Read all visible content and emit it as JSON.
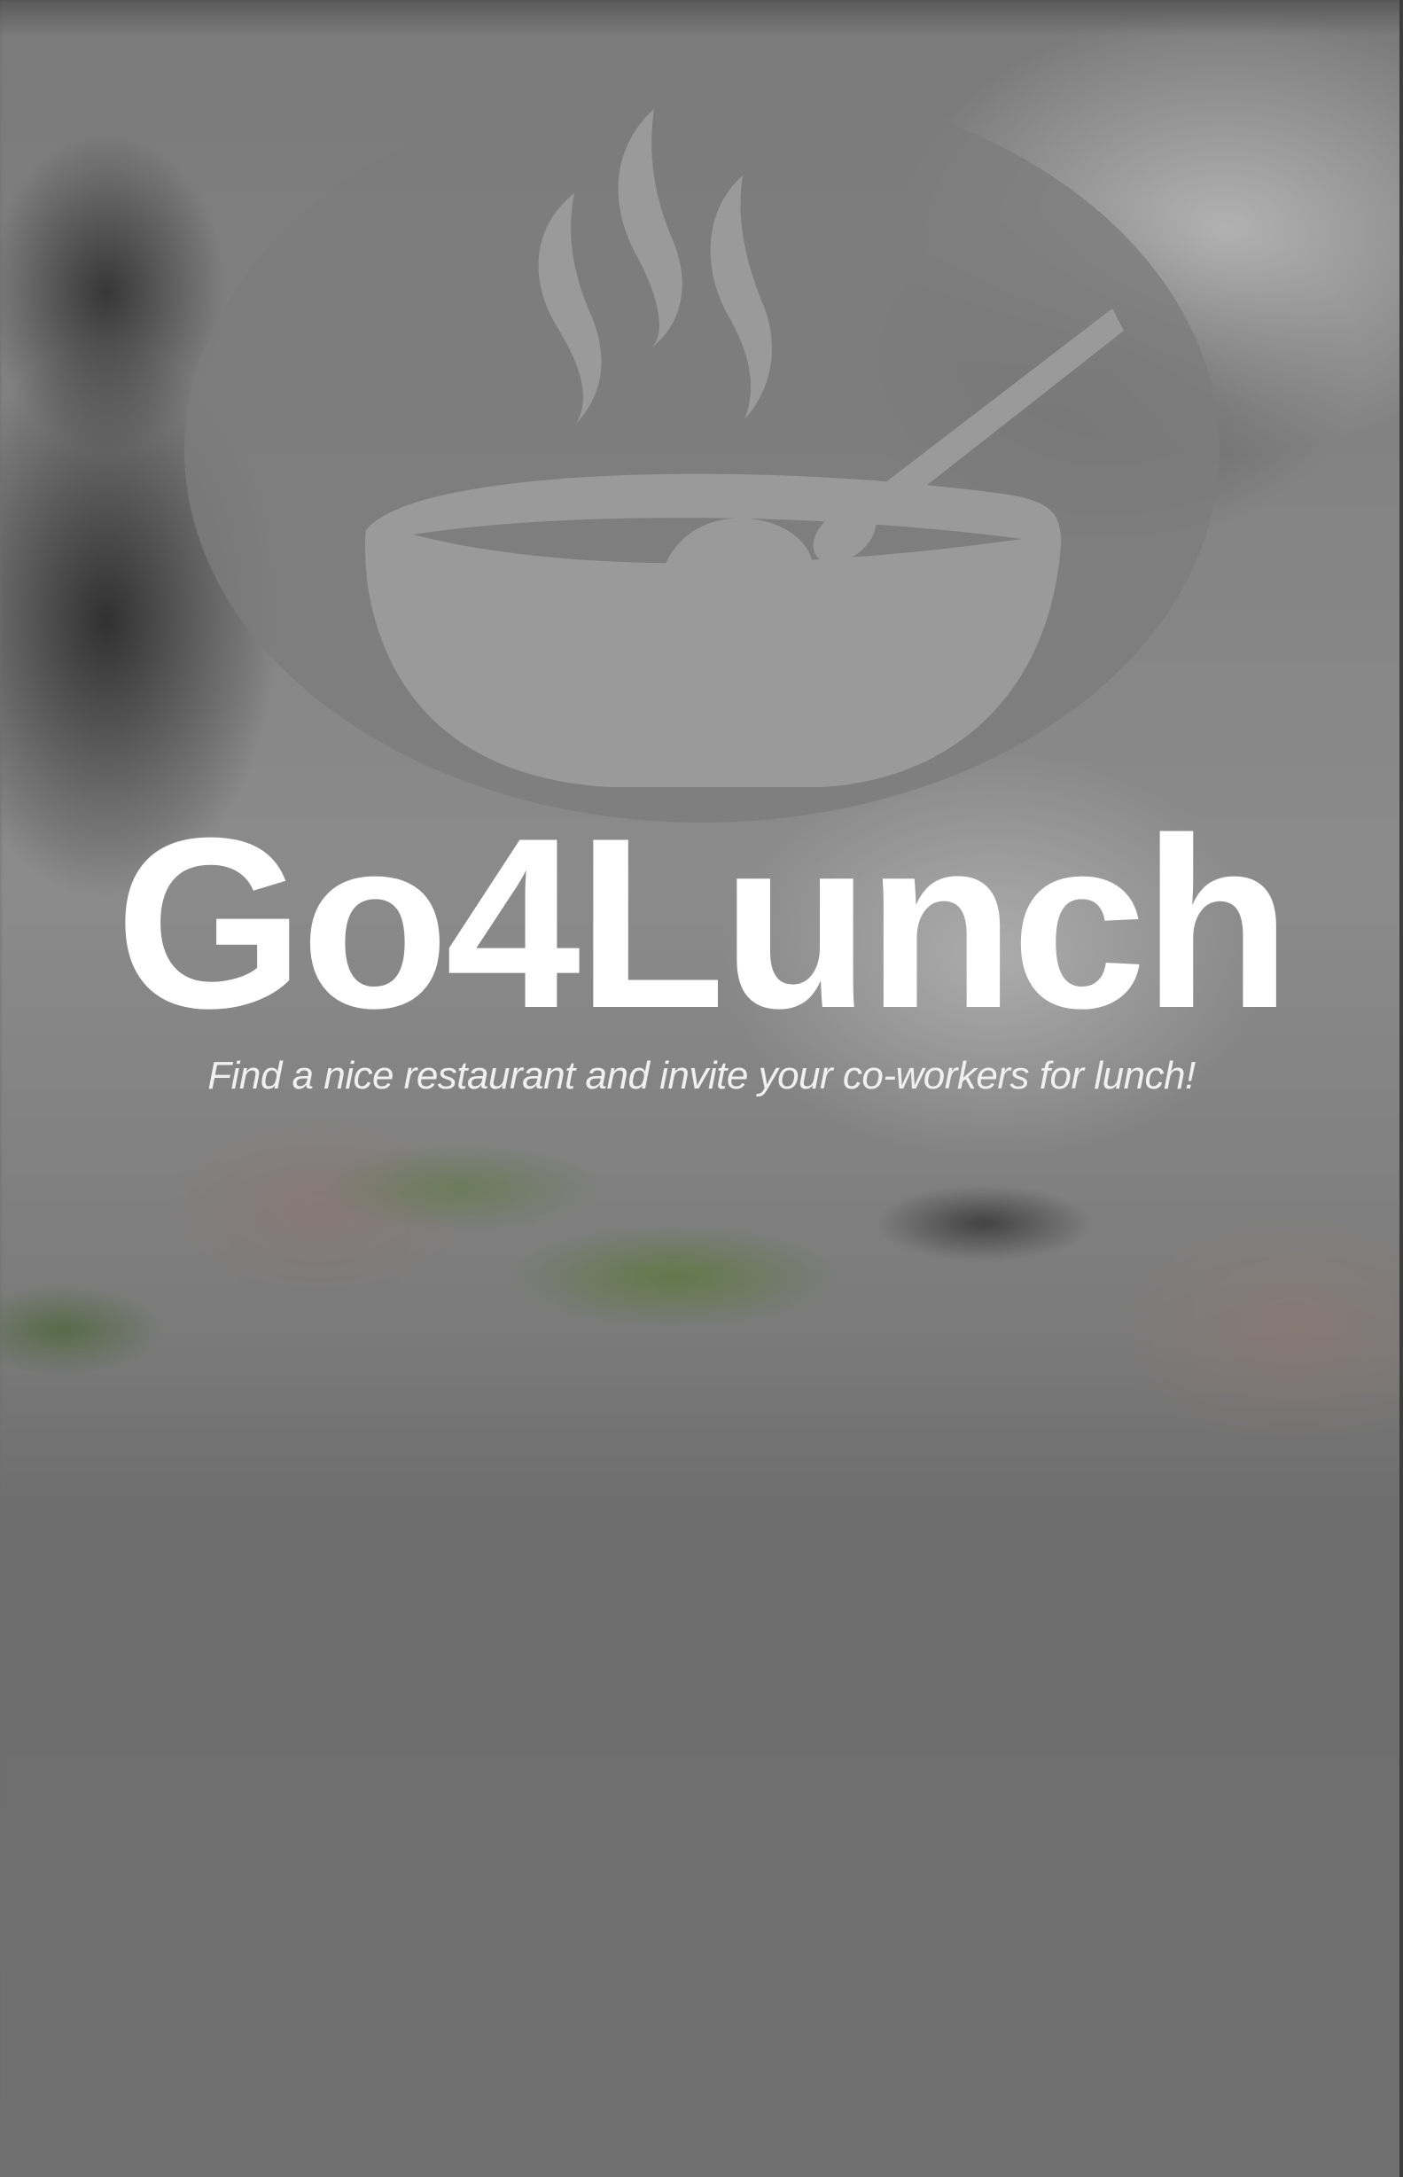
{
  "app": {
    "title": "Go4Lunch",
    "tagline": "Find a nice restaurant and invite your co-workers for lunch!"
  },
  "logo": {
    "icon": "steaming-bowl-with-spoon-icon",
    "badge_color": "#7d7d7d",
    "icon_color": "#999999"
  },
  "colors": {
    "overlay": "#6f6f6f",
    "title_text": "#ffffff"
  }
}
